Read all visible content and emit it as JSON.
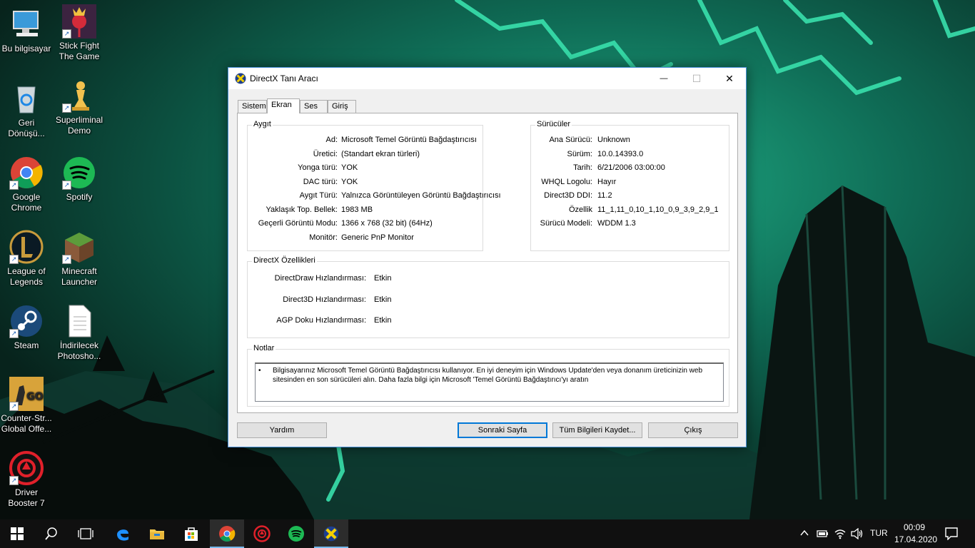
{
  "desktop": {
    "icons": [
      {
        "label": "Bu bilgisayar",
        "icon": "computer-icon"
      },
      {
        "label": "Stick Fight The Game",
        "icon": "stick-fight-icon"
      },
      {
        "label": "Geri Dönüşü...",
        "icon": "recycle-bin-icon"
      },
      {
        "label": "Superliminal Demo",
        "icon": "superliminal-icon"
      },
      {
        "label": "Google Chrome",
        "icon": "chrome-icon"
      },
      {
        "label": "Spotify",
        "icon": "spotify-icon"
      },
      {
        "label": "League of Legends",
        "icon": "league-icon"
      },
      {
        "label": "Minecraft Launcher",
        "icon": "minecraft-icon"
      },
      {
        "label": "Steam",
        "icon": "steam-icon"
      },
      {
        "label": "İndirilecek Photosho...",
        "icon": "document-icon"
      },
      {
        "label": "Counter-Str... Global Offe...",
        "icon": "csgo-icon"
      },
      {
        "label": "Driver Booster 7",
        "icon": "driver-booster-icon"
      }
    ]
  },
  "window": {
    "title": "DirectX Tanı Aracı",
    "controls": {
      "minimize": "—",
      "maximize": "☐",
      "close": "✕"
    },
    "tabs": [
      "Sistem",
      "Ekran",
      "Ses",
      "Giriş"
    ],
    "active_tab": "Ekran",
    "device": {
      "label": "Aygıt",
      "rows": [
        {
          "k": "Ad:",
          "v": "Microsoft Temel Görüntü Bağdaştırıcısı"
        },
        {
          "k": "Üretici:",
          "v": "(Standart ekran türleri)"
        },
        {
          "k": "Yonga türü:",
          "v": "YOK"
        },
        {
          "k": "DAC türü:",
          "v": "YOK"
        },
        {
          "k": "Aygıt Türü:",
          "v": "Yalnızca Görüntüleyen Görüntü Bağdaştırıcısı"
        },
        {
          "k": "Yaklaşık Top. Bellek:",
          "v": "1983 MB"
        },
        {
          "k": "Geçerli Görüntü Modu:",
          "v": "1366 x 768 (32 bit) (64Hz)"
        },
        {
          "k": "Monitör:",
          "v": "Generic PnP Monitor"
        }
      ]
    },
    "drivers": {
      "label": "Sürücüler",
      "rows": [
        {
          "k": "Ana Sürücü:",
          "v": "Unknown"
        },
        {
          "k": "Sürüm:",
          "v": "10.0.14393.0"
        },
        {
          "k": "Tarih:",
          "v": "6/21/2006 03:00:00"
        },
        {
          "k": "WHQL Logolu:",
          "v": "Hayır"
        },
        {
          "k": "Direct3D DDI:",
          "v": "11.2"
        },
        {
          "k": "Özellik",
          "v": "11_1,11_0,10_1,10_0,9_3,9_2,9_1"
        },
        {
          "k": "Sürücü Modeli:",
          "v": "WDDM 1.3"
        }
      ]
    },
    "features": {
      "label": "DirectX Özellikleri",
      "rows": [
        {
          "k": "DirectDraw Hızlandırması:",
          "v": "Etkin"
        },
        {
          "k": "Direct3D Hızlandırması:",
          "v": "Etkin"
        },
        {
          "k": "AGP Doku Hızlandırması:",
          "v": "Etkin"
        }
      ]
    },
    "notes": {
      "label": "Notlar",
      "bullet": "•",
      "text": "Bilgisayarınız Microsoft Temel Görüntü Bağdaştırıcısı kullanıyor. En iyi deneyim için Windows Update'den veya donanım üreticinizin web sitesinden en son sürücüleri alın. Daha fazla bilgi için Microsoft 'Temel Görüntü Bağdaştırıcı'yı aratın"
    },
    "buttons": {
      "help": "Yardım",
      "next": "Sonraki Sayfa",
      "save": "Tüm Bilgileri Kaydet...",
      "exit": "Çıkış"
    }
  },
  "taskbar": {
    "pinned": [
      "start-icon",
      "search-icon",
      "task-view-icon",
      "edge-icon",
      "file-explorer-icon",
      "store-icon",
      "chrome-icon",
      "driver-booster-icon",
      "spotify-icon",
      "directx-icon"
    ],
    "tray": {
      "language": "TUR",
      "time": "00:09",
      "date": "17.04.2020"
    }
  }
}
